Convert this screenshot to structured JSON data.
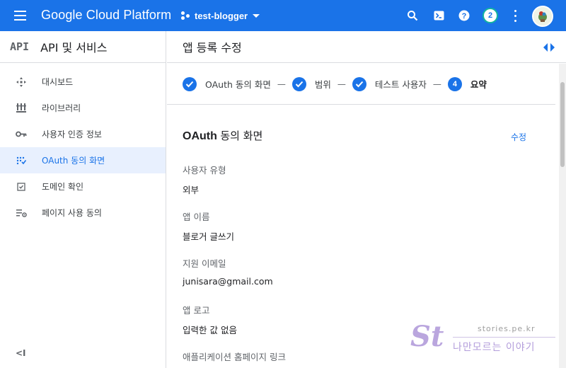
{
  "topbar": {
    "brand": "Google Cloud Platform",
    "project": "test-blogger",
    "notification_count": "2",
    "accent_color": "#1a73e8"
  },
  "sidebar": {
    "logo": "API",
    "title": "API 및 서비스",
    "items": [
      {
        "label": "대시보드",
        "icon": "dashboard-icon"
      },
      {
        "label": "라이브러리",
        "icon": "library-icon"
      },
      {
        "label": "사용자 인증 정보",
        "icon": "key-icon"
      },
      {
        "label": "OAuth 동의 화면",
        "icon": "consent-icon",
        "active": true
      },
      {
        "label": "도메인 확인",
        "icon": "domain-check-icon"
      },
      {
        "label": "페이지 사용 동의",
        "icon": "settings-list-icon"
      }
    ],
    "collapse_label": "<I"
  },
  "main": {
    "title": "앱 등록 수정",
    "steps": [
      {
        "label": "OAuth 동의 화면",
        "state": "done"
      },
      {
        "label": "범위",
        "state": "done"
      },
      {
        "label": "테스트 사용자",
        "state": "done"
      },
      {
        "label": "요약",
        "state": "current",
        "number": "4"
      }
    ],
    "step_separator": "—",
    "section": {
      "title_en": "OAuth",
      "title_kr": "동의 화면",
      "edit_label": "수정"
    },
    "fields": [
      {
        "label": "사용자 유형",
        "value": "외부"
      },
      {
        "label": "앱 이름",
        "value": "블로거 글쓰기"
      },
      {
        "label": "지원 이메일",
        "value": "junisara@gmail.com"
      },
      {
        "label": "앱 로고",
        "value": "입력한 값 없음"
      },
      {
        "label": "애플리케이션 홈페이지 링크",
        "value": ""
      }
    ]
  },
  "watermark": {
    "mark": "St",
    "url": "stories.pe.kr",
    "tagline": "나만모르는 이야기"
  }
}
